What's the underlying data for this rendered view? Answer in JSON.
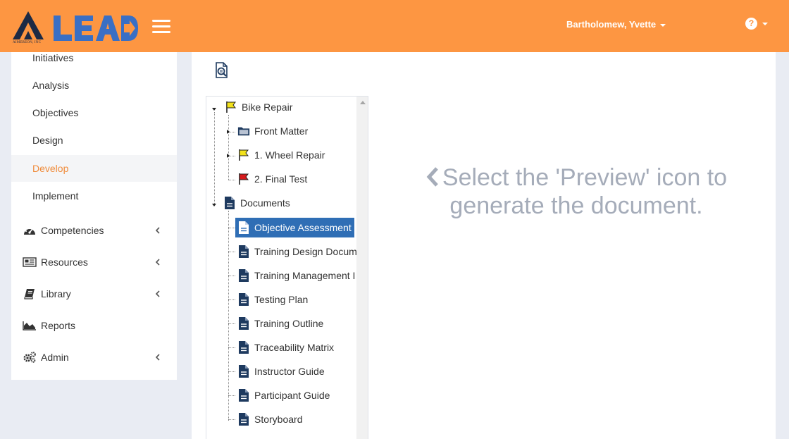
{
  "header": {
    "logo_text": "LEAD",
    "logo_subtext": "AIMEREON, INC",
    "user_name": "Bartholomew, Yvette",
    "help_icon": "question-circle-icon",
    "menu_icon": "hamburger-icon"
  },
  "colors": {
    "topbar": "#fd9642",
    "logo_blue": "#3a6fc4",
    "active_nav": "#f08b3a",
    "selected_node": "#2f6eb5",
    "doc_icon": "#1e3a5f"
  },
  "sidebar": {
    "sub_items": [
      {
        "label": "Initiatives"
      },
      {
        "label": "Analysis"
      },
      {
        "label": "Objectives"
      },
      {
        "label": "Design"
      },
      {
        "label": "Develop",
        "active": true
      },
      {
        "label": "Implement"
      }
    ],
    "main_items": [
      {
        "label": "Competencies",
        "icon": "dashboard-icon"
      },
      {
        "label": "Resources",
        "icon": "newspaper-icon"
      },
      {
        "label": "Library",
        "icon": "book-icon"
      },
      {
        "label": "Reports",
        "icon": "area-chart-icon"
      },
      {
        "label": "Admin",
        "icon": "cogs-icon"
      }
    ]
  },
  "toolbar": {
    "preview_icon": "search-document-icon"
  },
  "tree": {
    "root1": {
      "label": "Bike Repair",
      "icon": "yellow-flag-icon"
    },
    "root1_children": [
      {
        "label": "Front Matter",
        "icon": "folder-icon"
      },
      {
        "label": "1. Wheel Repair",
        "icon": "yellow-flag-icon"
      },
      {
        "label": "2. Final Test",
        "icon": "red-flag-icon"
      }
    ],
    "root2": {
      "label": "Documents",
      "icon": "document-icon"
    },
    "documents": [
      {
        "label": "Objective Assessment",
        "selected": true
      },
      {
        "label": "Training Design Docum"
      },
      {
        "label": "Training Management I"
      },
      {
        "label": "Testing Plan"
      },
      {
        "label": "Training Outline"
      },
      {
        "label": "Traceability Matrix"
      },
      {
        "label": "Instructor Guide"
      },
      {
        "label": "Participant Guide"
      },
      {
        "label": "Storyboard"
      }
    ]
  },
  "main": {
    "message_line1": "Select the 'Preview' icon to",
    "message_line2": "generate the document."
  }
}
